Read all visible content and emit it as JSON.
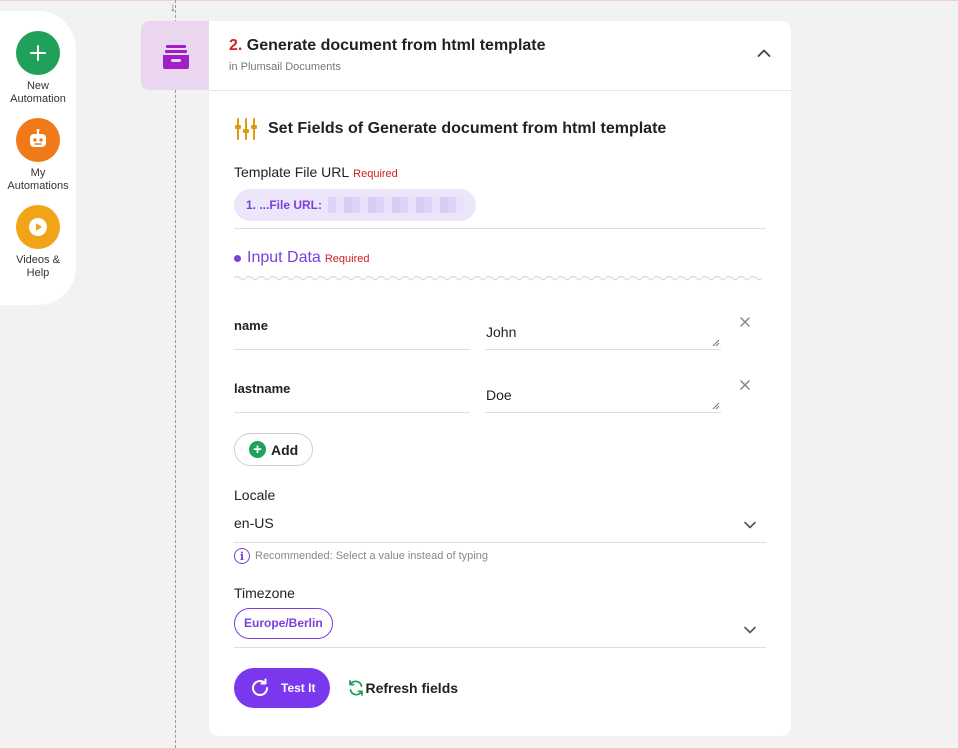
{
  "sidebar": {
    "items": [
      {
        "label_1": "New",
        "label_2": "Automation",
        "icon": "plus-icon",
        "color": "#1fa15a"
      },
      {
        "label_1": "My",
        "label_2": "Automations",
        "icon": "robot-icon",
        "color": "#f07a1a"
      },
      {
        "label_1": "Videos &",
        "label_2": "Help",
        "icon": "play-icon",
        "color": "#f2a419"
      }
    ]
  },
  "step": {
    "number": "2.",
    "title": "Generate document from html template",
    "subtitle": "in Plumsail Documents",
    "icon": "archive-drawer-icon"
  },
  "section": {
    "title": "Set Fields of Generate document from html template"
  },
  "template_url": {
    "label": "Template File URL",
    "required": "Required",
    "value": "1. ...File URL:"
  },
  "input_data": {
    "label": "Input Data",
    "required": "Required",
    "rows": [
      {
        "key": "name",
        "value": "John"
      },
      {
        "key": "lastname",
        "value": "Doe"
      }
    ],
    "add_label": "Add"
  },
  "locale": {
    "label": "Locale",
    "value": "en-US",
    "hint": "Recommended: Select a value instead of typing"
  },
  "timezone": {
    "label": "Timezone",
    "value": "Europe/Berlin"
  },
  "actions": {
    "test_label": "Test It",
    "refresh_label": "Refresh fields"
  },
  "colors": {
    "accent": "#7b37ee",
    "required": "#d32020",
    "add_green": "#1fa15a"
  }
}
